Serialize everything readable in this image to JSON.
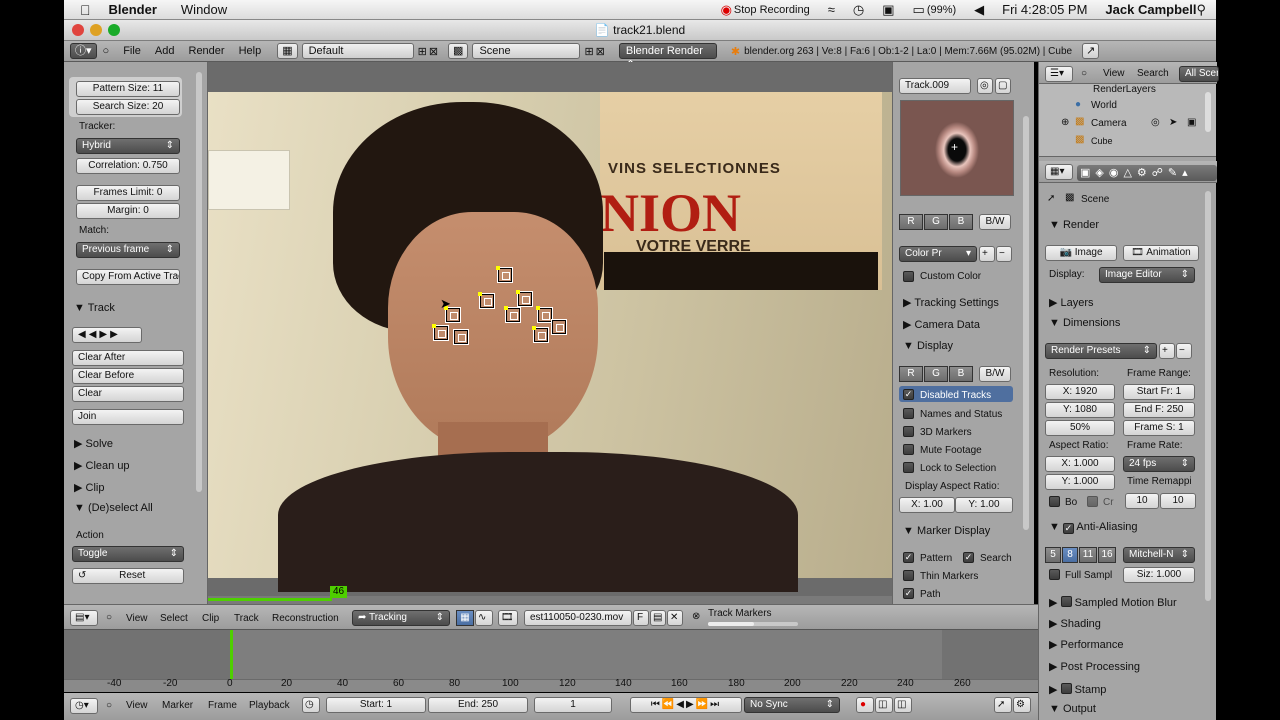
{
  "mac_menu": {
    "app": "Blender",
    "window": "Window",
    "recording": "Stop Recording",
    "battery": "(99%)",
    "clock": "Fri 4:28:05 PM",
    "user": "Jack Campbell"
  },
  "window_title": "track21.blend",
  "header": {
    "menus": [
      "File",
      "Add",
      "Render",
      "Help"
    ],
    "layout": "Default",
    "scene": "Scene",
    "engine": "Blender Render",
    "stats": "blender.org 263 | Ve:8 | Fa:6 | Ob:1-2 | La:0 | Mem:7.66M (95.02M) | Cube"
  },
  "tool_panel": {
    "pattern_size": "Pattern Size: 11",
    "search_size": "Search Size: 20",
    "tracker_label": "Tracker:",
    "tracker_value": "Hybrid",
    "correlation": "Correlation: 0.750",
    "frames_limit": "Frames Limit: 0",
    "margin": "Margin: 0",
    "match_label": "Match:",
    "match_value": "Previous frame",
    "copy_btn": "Copy From Active Track",
    "track_section": "Track",
    "clear_after": "Clear After",
    "clear_before": "Clear Before",
    "clear": "Clear",
    "join": "Join",
    "solve": "Solve",
    "cleanup": "Clean up",
    "clip": "Clip",
    "deselect": "(De)select All",
    "action_label": "Action",
    "action_value": "Toggle",
    "reset": "Reset"
  },
  "viewport": {
    "poster_line1": "VINS SELECTIONNES",
    "poster_line2": "NION",
    "poster_line3": "VOTRE VERRE",
    "current_frame": "46"
  },
  "clip_header": {
    "menus": [
      "View",
      "Select",
      "Clip",
      "Track",
      "Reconstruction"
    ],
    "mode": "Tracking",
    "clip_name": "est110050-0230.mov",
    "f": "F",
    "track_markers": "Track Markers"
  },
  "properties_n": {
    "track_name": "Track.009",
    "r": "R",
    "g": "G",
    "b": "B",
    "bw": "B/W",
    "color_preset": "Color Pr",
    "custom_color": "Custom Color",
    "tracking_settings": "Tracking Settings",
    "camera_data": "Camera Data",
    "display": "Display",
    "disabled_tracks": "Disabled Tracks",
    "names_status": "Names and Status",
    "markers_3d": "3D Markers",
    "mute_footage": "Mute Footage",
    "lock_selection": "Lock to Selection",
    "aspect_label": "Display Aspect Ratio:",
    "aspect_x": "X: 1.00",
    "aspect_y": "Y: 1.00",
    "marker_display": "Marker Display",
    "pattern": "Pattern",
    "search": "Search",
    "thin_markers": "Thin Markers",
    "path": "Path"
  },
  "outliner": {
    "menus": [
      "View",
      "Search"
    ],
    "filter": "All Scenes",
    "items": [
      "RenderLayers",
      "World",
      "Camera",
      "Cube"
    ]
  },
  "render_props": {
    "scene": "Scene",
    "render": "Render",
    "image": "Image",
    "animation": "Animation",
    "display_label": "Display:",
    "display_value": "Image Editor",
    "layers": "Layers",
    "dimensions": "Dimensions",
    "presets": "Render Presets",
    "resolution": "Resolution:",
    "res_x": "X: 1920",
    "res_y": "Y: 1080",
    "res_pct": "50%",
    "frame_range": "Frame Range:",
    "start": "Start Fr: 1",
    "end": "End F: 250",
    "step": "Frame S: 1",
    "aspect_ratio": "Aspect Ratio:",
    "asp_x": "X: 1.000",
    "asp_y": "Y: 1.000",
    "frame_rate": "Frame Rate:",
    "fps": "24 fps",
    "time_remap": "Time Remappi",
    "remap_old": "10",
    "remap_new": "10",
    "bo": "Bo",
    "cr": "Cr",
    "anti_aliasing": "Anti-Aliasing",
    "aa_samples": [
      "5",
      "8",
      "11",
      "16"
    ],
    "filter": "Mitchell-N",
    "full_sample": "Full Sampl",
    "size": "Siz: 1.000",
    "motion_blur": "Sampled Motion Blur",
    "shading": "Shading",
    "performance": "Performance",
    "post_processing": "Post Processing",
    "stamp": "Stamp",
    "output": "Output"
  },
  "timeline": {
    "ticks": [
      "-40",
      "-20",
      "0",
      "20",
      "40",
      "60",
      "80",
      "100",
      "120",
      "140",
      "160",
      "180",
      "200",
      "220",
      "240",
      "260"
    ],
    "menus": [
      "View",
      "Marker",
      "Frame",
      "Playback"
    ],
    "start": "Start: 1",
    "end": "End: 250",
    "current": "1",
    "sync": "No Sync"
  },
  "colors": {
    "bg_panel": "#a5a5a5",
    "header": "#9c9c9c",
    "marker": "#ffff00",
    "frame_indicator": "#4ecf00"
  }
}
